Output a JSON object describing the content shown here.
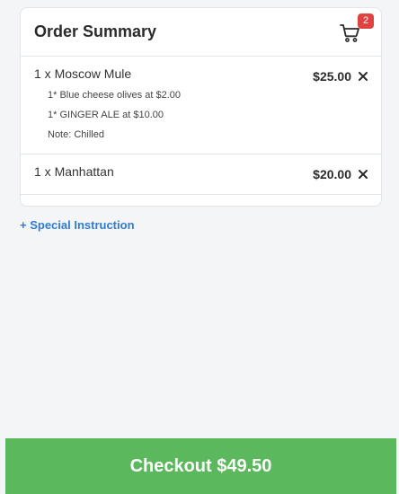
{
  "summary": {
    "title": "Order Summary",
    "cart_count": "2"
  },
  "items": [
    {
      "line": "1 x Moscow Mule",
      "price": "$25.00",
      "modifiers": [
        "1* Blue cheese olives at $2.00",
        "1* GINGER ALE at $10.00",
        "Note: Chilled"
      ]
    },
    {
      "line": "1 x Manhattan",
      "price": "$20.00",
      "modifiers": []
    }
  ],
  "special_instruction": "+ Special Instruction",
  "checkout_label": "Checkout $49.50",
  "icons": {
    "cart": "shopping-cart-icon",
    "remove": "close-icon"
  },
  "colors": {
    "checkout": "#5cb85c",
    "link": "#2f7bd6",
    "badge": "#e04141"
  }
}
